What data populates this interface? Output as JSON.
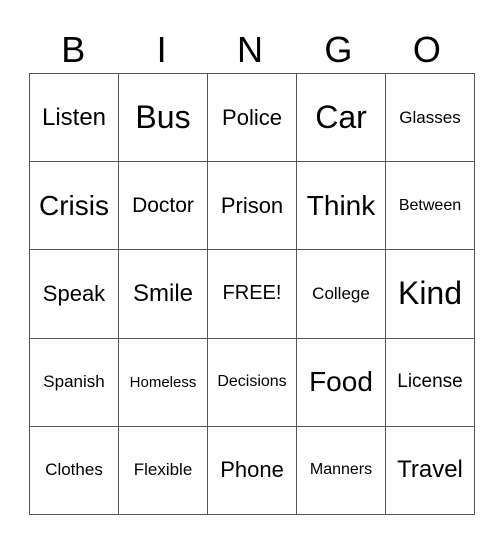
{
  "header": [
    "B",
    "I",
    "N",
    "G",
    "O"
  ],
  "rows": [
    [
      "Listen",
      "Bus",
      "Police",
      "Car",
      "Glasses"
    ],
    [
      "Crisis",
      "Doctor",
      "Prison",
      "Think",
      "Between"
    ],
    [
      "Speak",
      "Smile",
      "FREE!",
      "College",
      "Kind"
    ],
    [
      "Spanish",
      "Homeless",
      "Decisions",
      "Food",
      "License"
    ],
    [
      "Clothes",
      "Flexible",
      "Phone",
      "Manners",
      "Travel"
    ]
  ]
}
